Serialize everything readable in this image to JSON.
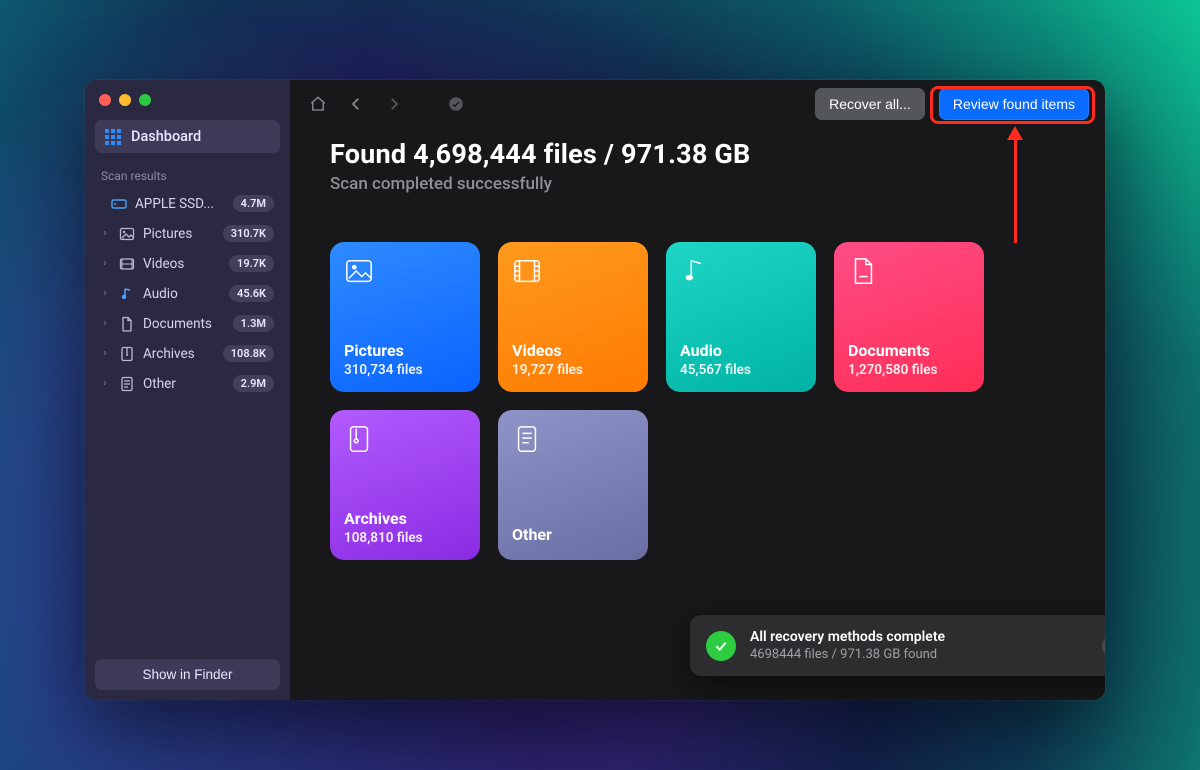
{
  "sidebar": {
    "dashboard_label": "Dashboard",
    "section_label": "Scan results",
    "drive": {
      "label": "APPLE SSD...",
      "count": "4.7M"
    },
    "items": [
      {
        "label": "Pictures",
        "count": "310.7K"
      },
      {
        "label": "Videos",
        "count": "19.7K"
      },
      {
        "label": "Audio",
        "count": "45.6K"
      },
      {
        "label": "Documents",
        "count": "1.3M"
      },
      {
        "label": "Archives",
        "count": "108.8K"
      },
      {
        "label": "Other",
        "count": "2.9M"
      }
    ],
    "finder_label": "Show in Finder"
  },
  "toolbar": {
    "recover_label": "Recover all...",
    "review_label": "Review found items"
  },
  "main": {
    "title": "Found 4,698,444 files / 971.38 GB",
    "subtitle": "Scan completed successfully"
  },
  "cards": {
    "pictures": {
      "title": "Pictures",
      "sub": "310,734 files"
    },
    "videos": {
      "title": "Videos",
      "sub": "19,727 files"
    },
    "audio": {
      "title": "Audio",
      "sub": "45,567 files"
    },
    "documents": {
      "title": "Documents",
      "sub": "1,270,580 files"
    },
    "archives": {
      "title": "Archives",
      "sub": "108,810 files"
    },
    "other": {
      "title": "Other",
      "sub": ""
    }
  },
  "toast": {
    "title": "All recovery methods complete",
    "subtitle": "4698444 files / 971.38 GB found"
  }
}
